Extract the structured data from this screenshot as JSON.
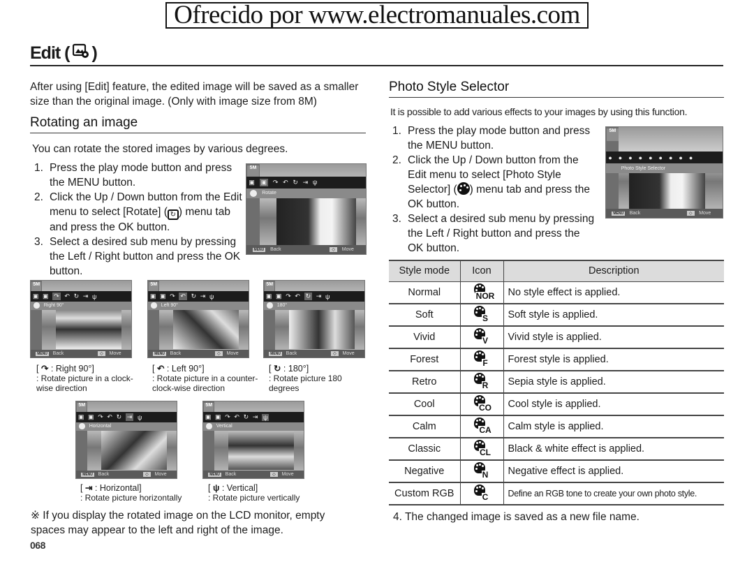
{
  "banner": "Ofrecido por www.electromanuales.com",
  "page": {
    "title": "Edit (",
    "title_close": ")",
    "title_icon": "edit-icon",
    "page_number": "068"
  },
  "left": {
    "intro": "After using [Edit] feature, the edited image will be saved as a smaller size than the original image. (Only with image size from 8M)",
    "section_title": "Rotating an image",
    "section_intro": "You can rotate the stored images by various degrees.",
    "steps": [
      {
        "num": "1.",
        "text": "Press the play mode button and press the MENU button."
      },
      {
        "num": "2.",
        "text_before": "Click the Up / Down button from the Edit menu to select [Rotate] (",
        "text_after": ") menu tab and press the OK button.",
        "icon": "rotate-icon"
      },
      {
        "num": "3.",
        "text": "Select a desired sub menu by pressing the Left / Right button and press the OK button."
      }
    ],
    "main_screen": {
      "size": "5M",
      "label": "Rotate",
      "back": "Back",
      "move": "Move",
      "menu_key": "MENU"
    },
    "options": [
      {
        "screen_label": "Right 90°",
        "icon": "rotate-right-icon",
        "glyph": "↷",
        "title": ": Right 90°]",
        "desc": ": Rotate picture in a clock-wise direction"
      },
      {
        "screen_label": "Left 90°",
        "icon": "rotate-left-icon",
        "glyph": "↶",
        "title": ": Left 90°]",
        "desc": ": Rotate picture in a counter-clock-wise direction"
      },
      {
        "screen_label": "180°",
        "icon": "rotate-180-icon",
        "glyph": "↻",
        "title": ": 180°]",
        "desc": ": Rotate picture 180 degrees"
      },
      {
        "screen_label": "Horizontal",
        "icon": "flip-horizontal-icon",
        "glyph": "⇥",
        "title": ": Horizontal]",
        "desc": ": Rotate picture horizontally"
      },
      {
        "screen_label": "Vertical",
        "icon": "flip-vertical-icon",
        "glyph": "ψ",
        "title": ": Vertical]",
        "desc": ": Rotate picture vertically"
      }
    ],
    "note": "※ If you display the rotated image on the LCD monitor, empty spaces may appear to the left and right of the image."
  },
  "right": {
    "section_title": "Photo Style Selector",
    "section_intro": "It is possible to add various effects to your images by using this function.",
    "steps": [
      {
        "num": "1.",
        "text": "Press the play mode button and press the MENU button."
      },
      {
        "num": "2.",
        "text_before": "Click the Up / Down button from the Edit menu to select [Photo Style Selector] (",
        "text_after": ") menu tab and press the OK button.",
        "icon": "photo-style-icon"
      },
      {
        "num": "3.",
        "text": "Select a desired sub menu by pressing the Left / Right button and press the OK button."
      }
    ],
    "screen": {
      "size": "5M",
      "label": "Photo Style Selector",
      "back": "Back",
      "move": "Move",
      "menu_key": "MENU"
    },
    "table": {
      "headers": [
        "Style mode",
        "Icon",
        "Description"
      ],
      "rows": [
        {
          "mode": "Normal",
          "icon_letters": "NOR",
          "desc": "No style effect is applied."
        },
        {
          "mode": "Soft",
          "icon_letters": "S",
          "desc": "Soft style is applied."
        },
        {
          "mode": "Vivid",
          "icon_letters": "V",
          "desc": "Vivid style is applied."
        },
        {
          "mode": "Forest",
          "icon_letters": "F",
          "desc": "Forest style is applied."
        },
        {
          "mode": "Retro",
          "icon_letters": "R",
          "desc": "Sepia style is applied."
        },
        {
          "mode": "Cool",
          "icon_letters": "CO",
          "desc": "Cool style is applied."
        },
        {
          "mode": "Calm",
          "icon_letters": "CA",
          "desc": "Calm style is applied."
        },
        {
          "mode": "Classic",
          "icon_letters": "CL",
          "desc": "Black & white effect is applied."
        },
        {
          "mode": "Negative",
          "icon_letters": "N",
          "desc": "Negative effect is applied."
        },
        {
          "mode": "Custom RGB",
          "icon_letters": "C",
          "desc": "Define an RGB tone to create your own photo style."
        }
      ]
    },
    "step4": "4. The changed image is saved as a new file name."
  }
}
